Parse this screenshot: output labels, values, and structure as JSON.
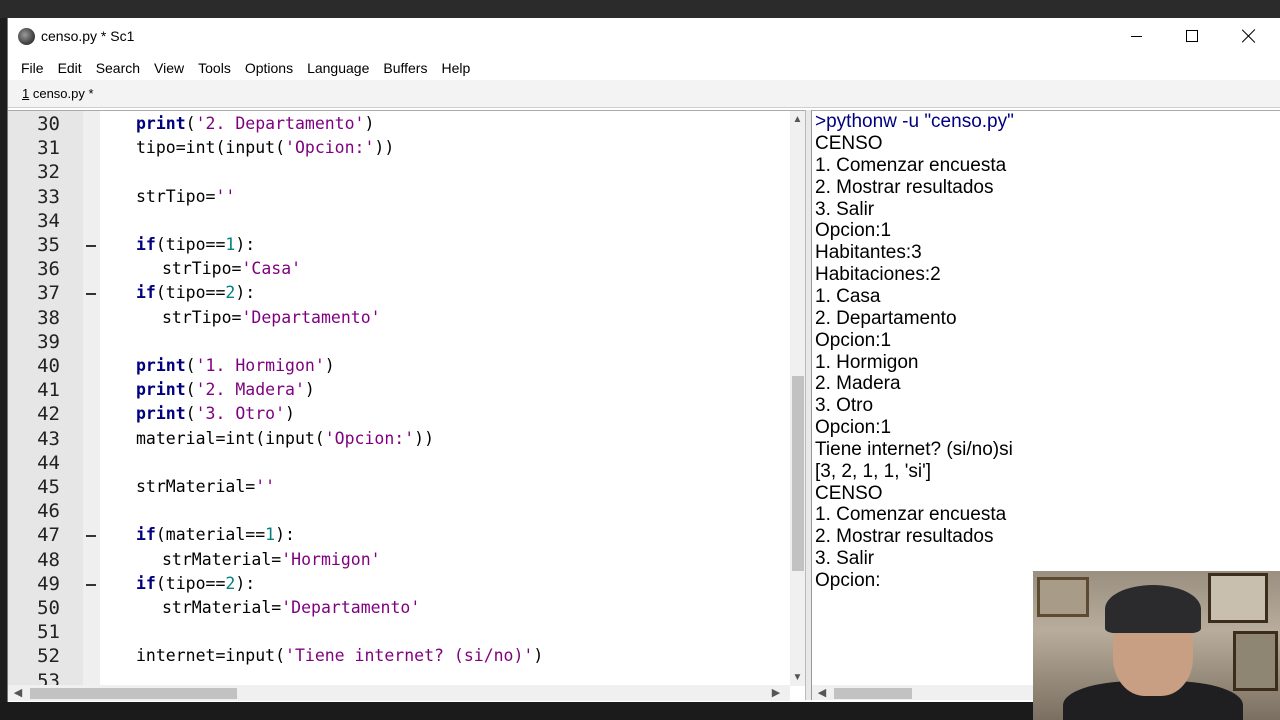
{
  "window": {
    "title": "censo.py * Sc1"
  },
  "menu": [
    "File",
    "Edit",
    "Search",
    "View",
    "Tools",
    "Options",
    "Language",
    "Buffers",
    "Help"
  ],
  "tab": {
    "number": "1",
    "label": " censo.py *"
  },
  "editor": {
    "lines": [
      {
        "n": "30",
        "indent": 1,
        "fold": false,
        "code": "print('2. Departamento')"
      },
      {
        "n": "31",
        "indent": 1,
        "fold": false,
        "code": "tipo=int(input('Opcion:'))"
      },
      {
        "n": "32",
        "indent": 0,
        "fold": false,
        "code": ""
      },
      {
        "n": "33",
        "indent": 1,
        "fold": false,
        "code": "strTipo=''"
      },
      {
        "n": "34",
        "indent": 0,
        "fold": false,
        "code": ""
      },
      {
        "n": "35",
        "indent": 1,
        "fold": true,
        "code": "if(tipo==1):"
      },
      {
        "n": "36",
        "indent": 2,
        "fold": false,
        "code": "strTipo='Casa'"
      },
      {
        "n": "37",
        "indent": 1,
        "fold": true,
        "code": "if(tipo==2):"
      },
      {
        "n": "38",
        "indent": 2,
        "fold": false,
        "code": "strTipo='Departamento'"
      },
      {
        "n": "39",
        "indent": 0,
        "fold": false,
        "code": ""
      },
      {
        "n": "40",
        "indent": 1,
        "fold": false,
        "code": "print('1. Hormigon')"
      },
      {
        "n": "41",
        "indent": 1,
        "fold": false,
        "code": "print('2. Madera')"
      },
      {
        "n": "42",
        "indent": 1,
        "fold": false,
        "code": "print('3. Otro')"
      },
      {
        "n": "43",
        "indent": 1,
        "fold": false,
        "code": "material=int(input('Opcion:'))"
      },
      {
        "n": "44",
        "indent": 0,
        "fold": false,
        "code": ""
      },
      {
        "n": "45",
        "indent": 1,
        "fold": false,
        "code": "strMaterial=''"
      },
      {
        "n": "46",
        "indent": 0,
        "fold": false,
        "code": ""
      },
      {
        "n": "47",
        "indent": 1,
        "fold": true,
        "code": "if(material==1):"
      },
      {
        "n": "48",
        "indent": 2,
        "fold": false,
        "code": "strMaterial='Hormigon'"
      },
      {
        "n": "49",
        "indent": 1,
        "fold": true,
        "code": "if(tipo==2):"
      },
      {
        "n": "50",
        "indent": 2,
        "fold": false,
        "code": "strMaterial='Departamento'"
      },
      {
        "n": "51",
        "indent": 0,
        "fold": false,
        "code": ""
      },
      {
        "n": "52",
        "indent": 1,
        "fold": false,
        "code": "internet=input('Tiene internet? (si/no)')"
      },
      {
        "n": "53",
        "indent": 0,
        "fold": false,
        "code": ""
      }
    ]
  },
  "output": {
    "command": ">pythonw -u \"censo.py\"",
    "lines": [
      "CENSO",
      "1. Comenzar encuesta",
      "2. Mostrar resultados",
      "3. Salir",
      "Opcion:1",
      "Habitantes:3",
      "Habitaciones:2",
      "1. Casa",
      "2. Departamento",
      "Opcion:1",
      "1. Hormigon",
      "2. Madera",
      "3. Otro",
      "Opcion:1",
      "Tiene internet? (si/no)si",
      "[3, 2, 1, 1, 'si']",
      "CENSO",
      "1. Comenzar encuesta",
      "2. Mostrar resultados",
      "3. Salir",
      "Opcion:"
    ]
  },
  "colors": {
    "keyword": "#00007f",
    "string": "#7f007f",
    "number": "#007f7f",
    "command": "#00007f"
  },
  "icons": {
    "app": "scite-app-icon",
    "minimize": "minimize-icon",
    "maximize": "maximize-icon",
    "close": "close-icon",
    "scroll_up": "chevron-up-icon",
    "scroll_down": "chevron-down-icon",
    "scroll_left": "chevron-left-icon",
    "scroll_right": "chevron-right-icon"
  }
}
